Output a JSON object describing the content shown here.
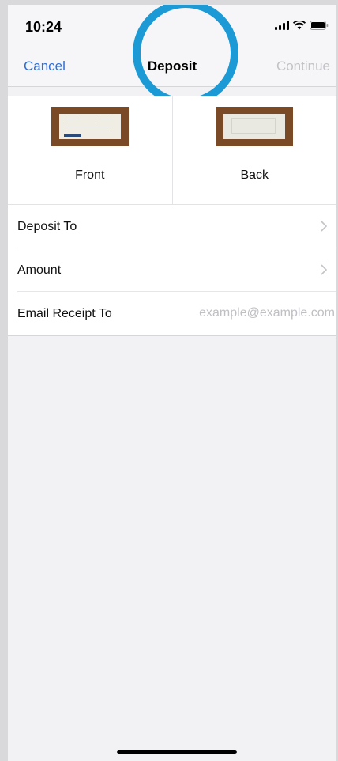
{
  "status_bar": {
    "time": "10:24",
    "icons": [
      "signal-icon",
      "wifi-icon",
      "battery-icon"
    ]
  },
  "nav": {
    "cancel_label": "Cancel",
    "title": "Deposit",
    "continue_label": "Continue"
  },
  "check_images": [
    {
      "label": "Front",
      "icon": "check-front-image"
    },
    {
      "label": "Back",
      "icon": "check-back-image"
    }
  ],
  "form": {
    "rows": [
      {
        "label": "Deposit To",
        "icon": "chevron-right-icon"
      },
      {
        "label": "Amount",
        "icon": "chevron-right-icon"
      },
      {
        "label": "Email Receipt To",
        "value": "",
        "placeholder": "example@example.com"
      }
    ]
  },
  "colors": {
    "accent": "#2f6fd8",
    "disabled": "#c3c3c7",
    "highlight_ring": "#1b9ad6",
    "background": "#f2f2f4"
  }
}
